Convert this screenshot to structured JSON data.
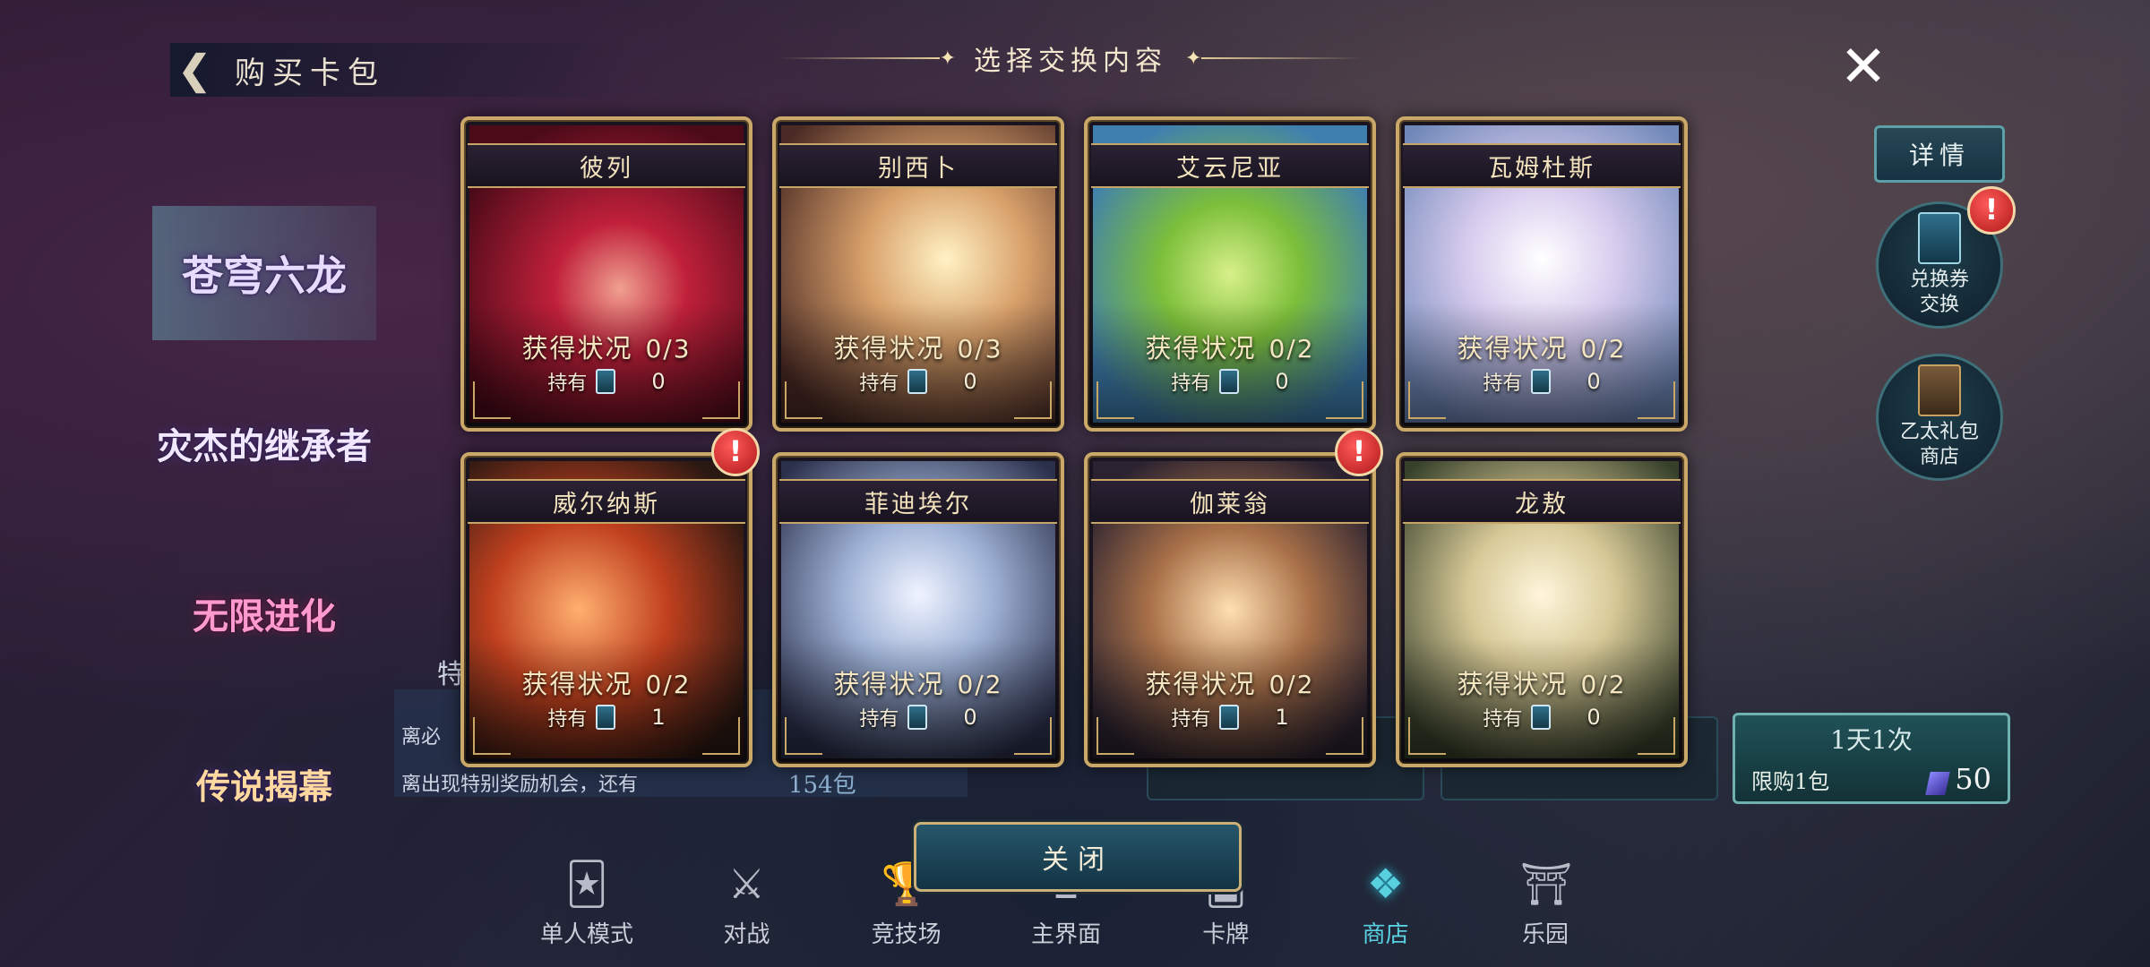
{
  "header": {
    "title": "购买卡包"
  },
  "categories": [
    {
      "label": "苍穹六龙",
      "active": true
    },
    {
      "label": "灾杰的继承者"
    },
    {
      "label": "无限进化"
    },
    {
      "label": "传说揭幕"
    }
  ],
  "dialog": {
    "title": "选择交换内容",
    "close_label": "关闭"
  },
  "right_panel": {
    "detail_label": "详情",
    "voucher_line1": "兑换券",
    "voucher_line2": "交换",
    "ether_line1": "乙太礼包",
    "ether_line2": "商店"
  },
  "cards": [
    {
      "name": "彼列",
      "status_label": "获得状况",
      "status": "0/3",
      "own_label": "持有",
      "own": "0"
    },
    {
      "name": "别西卜",
      "status_label": "获得状况",
      "status": "0/3",
      "own_label": "持有",
      "own": "0"
    },
    {
      "name": "艾云尼亚",
      "status_label": "获得状况",
      "status": "0/2",
      "own_label": "持有",
      "own": "0"
    },
    {
      "name": "瓦姆杜斯",
      "status_label": "获得状况",
      "status": "0/2",
      "own_label": "持有",
      "own": "0"
    },
    {
      "name": "威尔纳斯",
      "status_label": "获得状况",
      "status": "0/2",
      "own_label": "持有",
      "own": "1"
    },
    {
      "name": "菲迪埃尔",
      "status_label": "获得状况",
      "status": "0/2",
      "own_label": "持有",
      "own": "0"
    },
    {
      "name": "伽莱翁",
      "status_label": "获得状况",
      "status": "0/2",
      "own_label": "持有",
      "own": "1"
    },
    {
      "name": "龙敖",
      "status_label": "获得状况",
      "status": "0/2",
      "own_label": "持有",
      "own": "0"
    }
  ],
  "shop_background": {
    "line1": "离必",
    "line2": "离出现特别奖励机会，还有",
    "packs_left": "154包",
    "tag": "特"
  },
  "limit_offer": {
    "title": "1天1次",
    "label": "限购1包",
    "price": "50"
  },
  "nav": [
    {
      "label": "单人模式",
      "icon": "solo-mode-icon",
      "glyph": "🃏"
    },
    {
      "label": "对战",
      "icon": "battle-icon",
      "glyph": "⚔"
    },
    {
      "label": "竞技场",
      "icon": "arena-icon",
      "glyph": "🏆"
    },
    {
      "label": "主界面",
      "icon": "home-icon",
      "glyph": "⌂"
    },
    {
      "label": "卡牌",
      "icon": "cards-icon",
      "glyph": "🂠"
    },
    {
      "label": "商店",
      "icon": "shop-icon",
      "glyph": "❖",
      "active": true
    },
    {
      "label": "乐园",
      "icon": "park-icon",
      "glyph": "⛩"
    }
  ],
  "alerts": {
    "symbol": "!"
  },
  "colors": {
    "accent": "#58d0e0",
    "gold": "#caa86a",
    "alert": "#d02020"
  }
}
